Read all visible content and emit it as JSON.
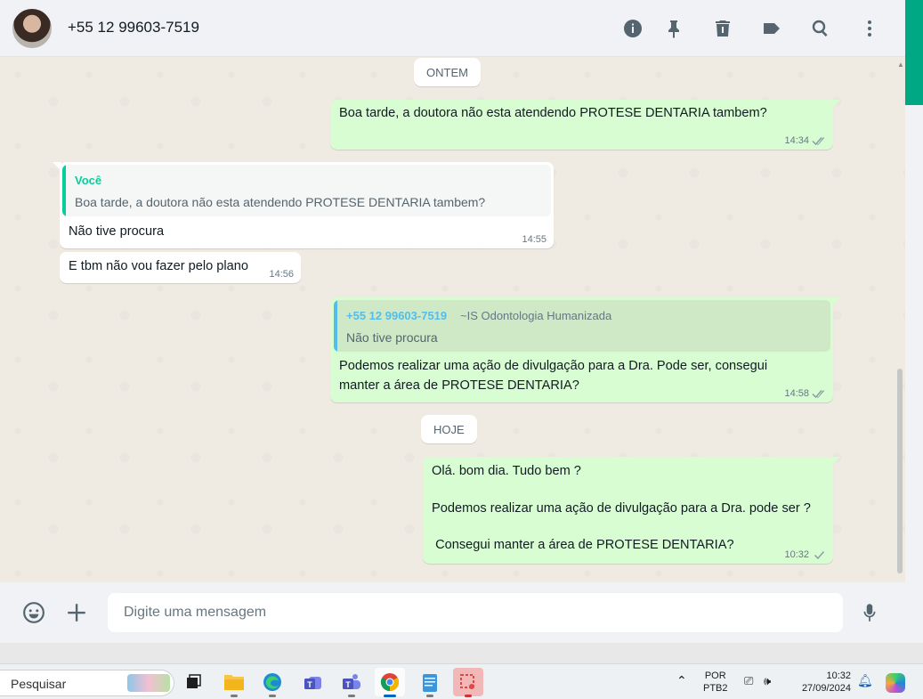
{
  "header": {
    "contact_name": "+55 12 99603-7519",
    "icons": [
      "info-icon",
      "pin-icon",
      "trash-icon",
      "label-icon",
      "search-icon",
      "menu-icon"
    ]
  },
  "chat": {
    "date_yesterday": "ONTEM",
    "date_today": "HOJE",
    "messages": [
      {
        "direction": "out",
        "text": "Boa tarde, a doutora não esta atendendo PROTESE DENTARIA tambem?",
        "time": "14:34",
        "status": "read"
      },
      {
        "direction": "in",
        "quote_name": "Você",
        "quote_text": "Boa tarde, a doutora não esta atendendo PROTESE DENTARIA tambem?",
        "text": "Não tive procura",
        "time": "14:55"
      },
      {
        "direction": "in",
        "text": "E tbm não vou fazer pelo plano",
        "time": "14:56"
      },
      {
        "direction": "out",
        "quote_name": "+55 12 99603-7519",
        "quote_sub": "~IS Odontologia Humanizada",
        "quote_text": "Não tive procura",
        "text": "Podemos realizar uma ação de divulgação para a Dra. Pode ser, consegui\nmanter a área de PROTESE DENTARIA?",
        "time": "14:58",
        "status": "read"
      },
      {
        "direction": "out",
        "text": "Olá. bom dia. Tudo bem ?\n\nPodemos realizar uma ação de divulgação para a Dra. pode ser ?\n\n Consegui manter a área de PROTESE DENTARIA?",
        "time": "10:32",
        "status": "sent"
      }
    ]
  },
  "composer": {
    "placeholder": "Digite uma mensagem",
    "icons": [
      "emoji-icon",
      "plus-icon",
      "mic-icon"
    ]
  },
  "taskbar": {
    "search_label": "Pesquisar",
    "language": "POR",
    "keyboard": "PTB2",
    "time": "10:32",
    "date": "27/09/2024"
  },
  "colors": {
    "accent": "#00a884",
    "outgoing_bubble": "#d9fdd3",
    "chat_background": "#efeae2",
    "quote_bar_you": "#06cf9c",
    "quote_name_contact": "#53bdeb"
  }
}
